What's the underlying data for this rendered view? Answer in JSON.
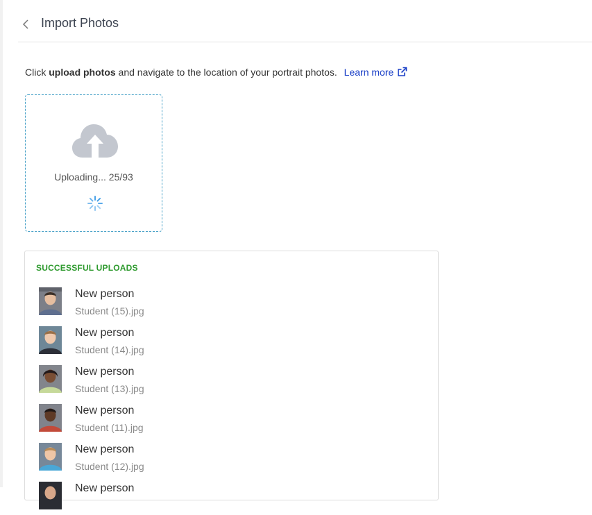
{
  "header": {
    "title": "Import Photos"
  },
  "instructions": {
    "prefix": "Click ",
    "bold": "upload photos",
    "suffix": " and navigate to the location of your portrait photos.",
    "learn_more": "Learn more"
  },
  "upload": {
    "status": "Uploading... 25/93",
    "uploaded": 25,
    "total": 93
  },
  "successful": {
    "title": "SUCCESSFUL UPLOADS",
    "items": [
      {
        "name": "New person",
        "file": "Student (15).jpg"
      },
      {
        "name": "New person",
        "file": "Student (14).jpg"
      },
      {
        "name": "New person",
        "file": "Student (13).jpg"
      },
      {
        "name": "New person",
        "file": "Student (11).jpg"
      },
      {
        "name": "New person",
        "file": "Student (12).jpg"
      },
      {
        "name": "New person",
        "file": ""
      }
    ]
  },
  "colors": {
    "accent_link": "#1a3fc7",
    "success": "#2e9a2e",
    "dropzone_border": "#49a2c8",
    "cloud": "#c3c7cf"
  },
  "icons": [
    "chevron-left-icon",
    "external-link-icon",
    "cloud-upload-icon",
    "spinner-icon"
  ]
}
